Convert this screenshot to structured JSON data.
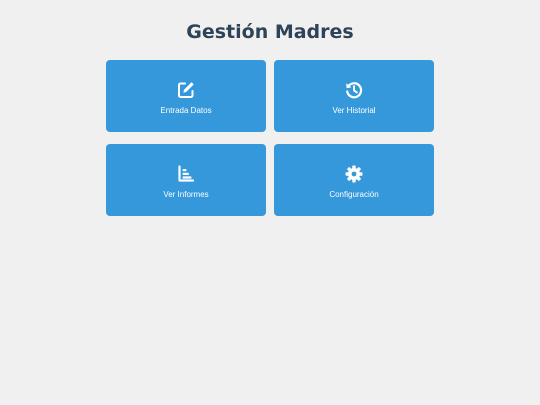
{
  "header": {
    "title": "Gestión Madres"
  },
  "menu": {
    "items": [
      {
        "label": "Entrada Datos",
        "icon": "edit-icon"
      },
      {
        "label": "Ver Historial",
        "icon": "history-icon"
      },
      {
        "label": "Ver Informes",
        "icon": "report-icon"
      },
      {
        "label": "Configuración",
        "icon": "gear-icon"
      }
    ]
  },
  "colors": {
    "background": "#f0f0f0",
    "tile": "#3498db",
    "title": "#2e4258",
    "tile_text": "#ffffff"
  }
}
